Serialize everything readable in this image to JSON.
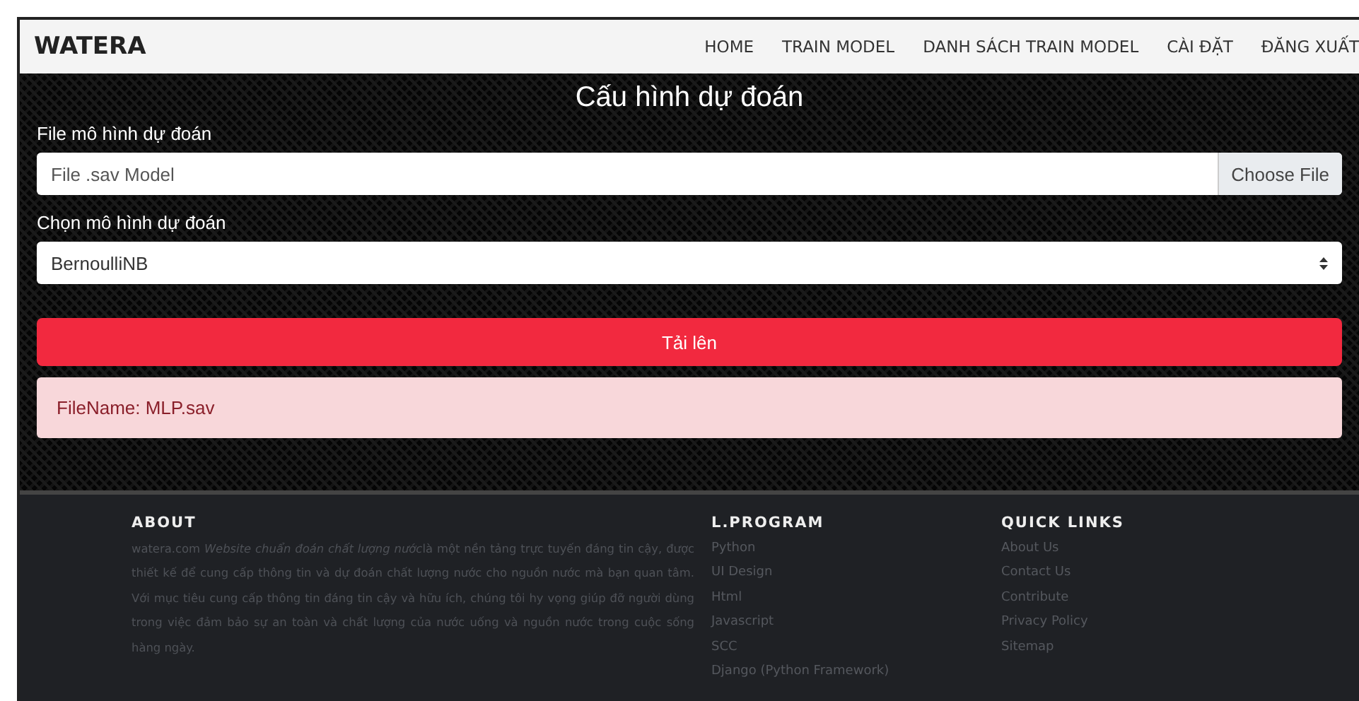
{
  "navbar": {
    "brand": "WATERA",
    "links": [
      {
        "label": "HOME"
      },
      {
        "label": "TRAIN MODEL"
      },
      {
        "label": "DANH SÁCH TRAIN MODEL"
      },
      {
        "label": "CÀI ĐẶT"
      },
      {
        "label": "ĐĂNG XUẤT"
      }
    ]
  },
  "form": {
    "title": "Cấu hình dự đoán",
    "file_label": "File mô hình dự đoán",
    "file_placeholder": "File .sav Model",
    "file_button": "Choose File",
    "select_label": "Chọn mô hình dự đoán",
    "select_value": "BernoulliNB",
    "submit": "Tải lên",
    "alert": "FileName: MLP.sav"
  },
  "footer": {
    "about": {
      "heading": "ABOUT",
      "text_start": "watera.com ",
      "text_italic": "Website chuẩn đoán chất lượng nước",
      "text_end": "là một nền tảng trực tuyến đáng tin cậy, được thiết kế để cung cấp thông tin và dự đoán chất lượng nước cho nguồn nước mà bạn quan tâm. Với mục tiêu cung cấp thông tin đáng tin cậy và hữu ích, chúng tôi hy vọng giúp đỡ người dùng trong việc đảm bảo sự an toàn và chất lượng của nước uống và nguồn nước trong cuộc sống hàng ngày."
    },
    "columns": [
      {
        "heading": "L.PROGRAM",
        "links": [
          "Python",
          "UI Design",
          "Html",
          "Javascript",
          "SCC",
          "Django (Python Framework)"
        ]
      },
      {
        "heading": "QUICK LINKS",
        "links": [
          "About Us",
          "Contact Us",
          "Contribute",
          "Privacy Policy",
          "Sitemap"
        ]
      }
    ]
  }
}
